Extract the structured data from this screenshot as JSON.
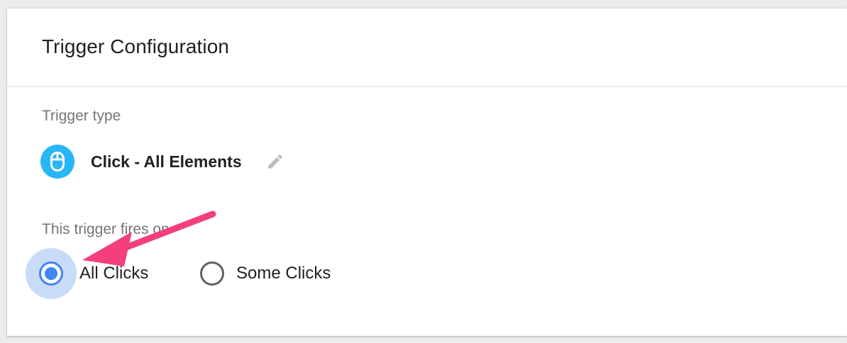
{
  "card": {
    "title": "Trigger Configuration"
  },
  "trigger_type": {
    "label": "Trigger type",
    "name": "Click - All Elements",
    "icon": "mouse-icon",
    "icon_color": "#29b6f6",
    "edit_icon": "pencil-icon"
  },
  "fires_on": {
    "label": "This trigger fires on",
    "options": [
      {
        "label": "All Clicks",
        "selected": true
      },
      {
        "label": "Some Clicks",
        "selected": false
      }
    ],
    "accent_color": "#4285f4"
  },
  "annotation": {
    "type": "arrow",
    "color": "#f43f7a",
    "points_to": "All Clicks"
  }
}
